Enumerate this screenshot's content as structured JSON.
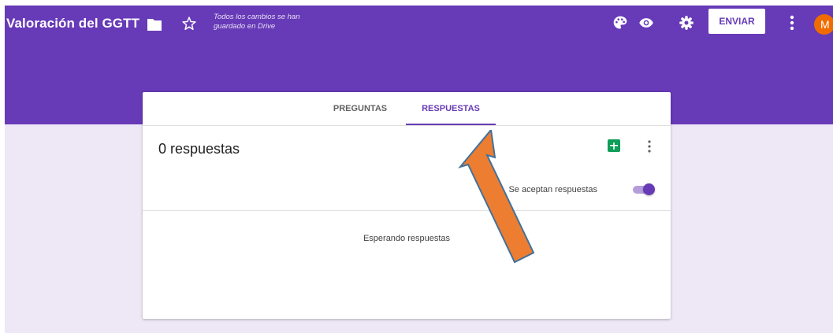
{
  "header": {
    "title": "Valoración del GGTT",
    "save_status": "Todos los cambios se han guardado en Drive",
    "send_label": "ENVIAR",
    "avatar_initial": "M",
    "icons": [
      "folder-icon",
      "star-icon",
      "palette-icon",
      "eye-icon",
      "gear-icon",
      "more-vert-icon"
    ]
  },
  "tabs": [
    {
      "label": "PREGUNTAS",
      "active": false
    },
    {
      "label": "RESPUESTAS",
      "active": true
    }
  ],
  "responses": {
    "count_label": "0 respuestas",
    "accepting_label": "Se aceptan respuestas",
    "accepting": true,
    "empty_label": "Esperando respuestas"
  },
  "colors": {
    "primary": "#673ab7",
    "background": "#ede7f6",
    "sheets_green": "#0f9d58",
    "avatar": "#ef6c00",
    "arrow_fill": "#ed7d31",
    "arrow_stroke": "#41719c"
  }
}
